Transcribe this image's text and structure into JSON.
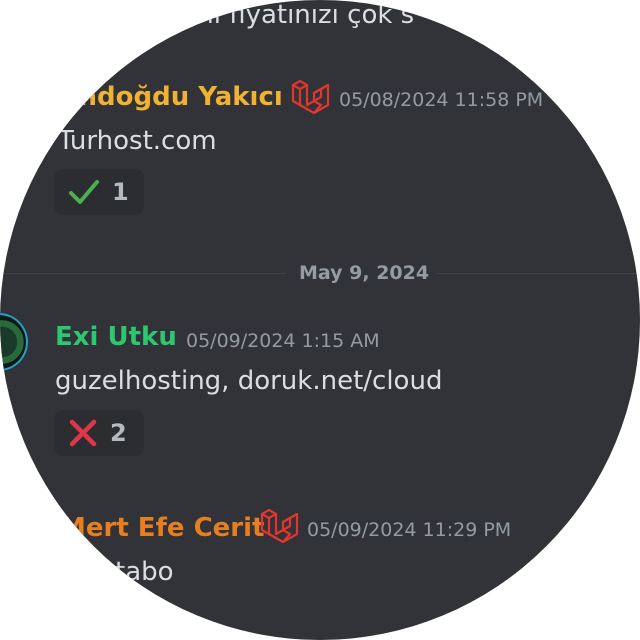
{
  "messages": [
    {
      "author": "ündoğdu Yakıcı",
      "author_color": "#f0b232",
      "timestamp": "05/08/2024 11:58 PM",
      "text": "Turhost.com",
      "reaction": {
        "emoji": "check-icon",
        "count": "1"
      }
    },
    {
      "author": "Exi Utku",
      "author_color": "#2dc770",
      "timestamp": "05/09/2024 1:15 AM",
      "text": "guzelhosting, doruk.net/cloud",
      "reaction": {
        "emoji": "cross-icon",
        "count": "2"
      }
    },
    {
      "author": "Mert Efe Cerit",
      "author_color": "#e67e22",
      "timestamp": "05/09/2024 11:29 PM",
      "text": "tabo"
    }
  ],
  "top_partial_text": "ini fiyatınızı çok s",
  "date_divider": "May 9, 2024",
  "colors": {
    "background": "#313338",
    "role_icon": "#e0362e"
  }
}
